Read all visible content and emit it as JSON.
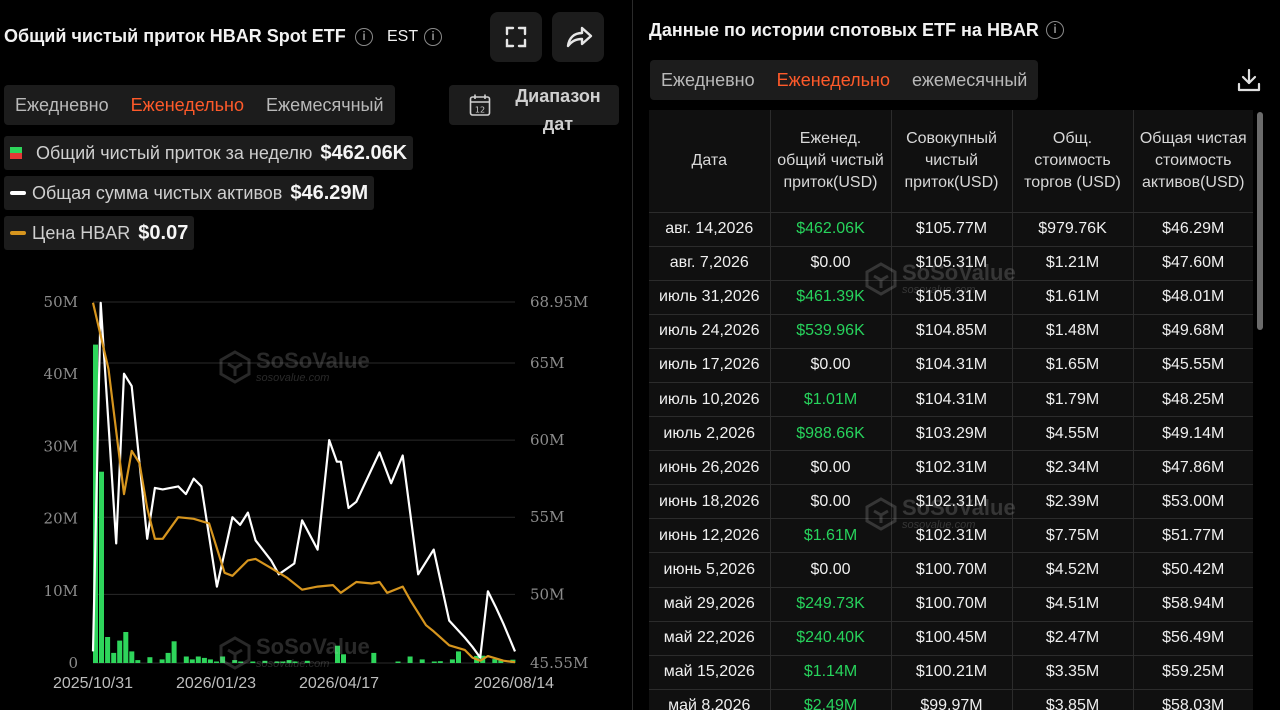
{
  "left": {
    "title": "Общий чистый приток HBAR Spot ETF",
    "timezone": "EST",
    "tabs": [
      "Ежедневно",
      "Еженедельно",
      "Ежемесячный"
    ],
    "active_tab": 1,
    "date_range": "Диапазон дат",
    "legend": [
      {
        "label": "Общий чистый приток за неделю",
        "value": "$462.06K"
      },
      {
        "label": "Общая сумма чистых активов",
        "value": "$46.29M"
      },
      {
        "label": "Цена HBAR",
        "value": "$0.07"
      }
    ],
    "watermark": {
      "name": "SoSoValue",
      "site": "sosovalue.com"
    }
  },
  "colors": {
    "accent": "#ff5a2a",
    "inflow": "#2ed55b",
    "outflow": "#e53935",
    "assets": "#ffffff",
    "price": "#d6951e"
  },
  "chart_data": {
    "type": "bar",
    "x_ticks": [
      "2025/10/31",
      "2026/01/23",
      "2026/04/17",
      "2026/08/14"
    ],
    "y_left_ticks": [
      "0",
      "10M",
      "20M",
      "30M",
      "40M",
      "50M"
    ],
    "y_right_ticks": [
      "45.55M",
      "50M",
      "55M",
      "60M",
      "65M",
      "68.95M"
    ],
    "ylim_left": [
      0,
      50000000
    ],
    "ylim_right": [
      45550000,
      68950000
    ],
    "price_range": [
      0.06,
      0.3
    ],
    "series": [
      {
        "name": "Общий чистый приток за неделю",
        "type": "bar",
        "axis": "left",
        "values": [
          44.1,
          26.5,
          3.6,
          1.4,
          3.1,
          4.3,
          1.6,
          0.4,
          0,
          0.8,
          0,
          0.5,
          1.4,
          3.0,
          0,
          0.9,
          0.5,
          0.9,
          0.7,
          0.5,
          0.2,
          0.9,
          0,
          0.4,
          0.2,
          0,
          0.1,
          0,
          0.3,
          0,
          0.1,
          0.2,
          0.4,
          0.1,
          0,
          0.3,
          0,
          0,
          0,
          0,
          2.4,
          1.2,
          0,
          0,
          0,
          0,
          1.4,
          0,
          0,
          0,
          0.2,
          0,
          0.9,
          0,
          0.5,
          0,
          0.2,
          0.25,
          0,
          0.5,
          1.61,
          0,
          0,
          0.99,
          1.01,
          0,
          0.54,
          0.46,
          0,
          0.46
        ]
      },
      {
        "name": "Общая сумма чистых активов",
        "type": "line",
        "axis": "right",
        "points": [
          [
            0,
            46.3
          ],
          [
            2,
            68.9
          ],
          [
            6,
            53.3
          ],
          [
            8,
            64.3
          ],
          [
            10,
            63.5
          ],
          [
            14,
            53.6
          ],
          [
            16,
            56.9
          ],
          [
            18,
            56.8
          ],
          [
            22,
            57.0
          ],
          [
            24,
            56.5
          ],
          [
            26,
            57.5
          ],
          [
            28,
            57.0
          ],
          [
            32,
            50.5
          ],
          [
            36,
            55.0
          ],
          [
            38,
            54.5
          ],
          [
            40,
            55.3
          ],
          [
            42,
            53.5
          ],
          [
            46,
            52.2
          ],
          [
            48,
            51.3
          ],
          [
            52,
            52.0
          ],
          [
            54,
            54.8
          ],
          [
            58,
            52.9
          ],
          [
            61,
            60.0
          ],
          [
            63,
            58.6
          ],
          [
            64,
            58.6
          ],
          [
            66,
            55.6
          ],
          [
            68,
            56.0
          ],
          [
            74,
            59.2
          ],
          [
            77,
            57.2
          ],
          [
            80,
            59.0
          ],
          [
            84,
            51.3
          ],
          [
            88,
            52.9
          ],
          [
            92,
            48.3
          ],
          [
            96,
            47.2
          ],
          [
            98,
            46.6
          ],
          [
            100,
            45.9
          ],
          [
            102,
            50.2
          ],
          [
            104,
            49.2
          ],
          [
            106,
            48.1
          ],
          [
            109,
            46.3
          ]
        ]
      },
      {
        "name": "Цена HBAR",
        "type": "line",
        "axis": "right",
        "points": [
          [
            0,
            68.9
          ],
          [
            4,
            64.6
          ],
          [
            8,
            56.5
          ],
          [
            10,
            59.3
          ],
          [
            12,
            58.5
          ],
          [
            14,
            55.6
          ],
          [
            16,
            53.6
          ],
          [
            18,
            53.6
          ],
          [
            22,
            55.0
          ],
          [
            26,
            54.9
          ],
          [
            30,
            54.6
          ],
          [
            34,
            51.4
          ],
          [
            36,
            51.2
          ],
          [
            40,
            52.2
          ],
          [
            42,
            52.3
          ],
          [
            46,
            51.7
          ],
          [
            50,
            51.1
          ],
          [
            54,
            50.3
          ],
          [
            58,
            50.5
          ],
          [
            62,
            50.6
          ],
          [
            64,
            50.1
          ],
          [
            68,
            50.8
          ],
          [
            72,
            50.7
          ],
          [
            74,
            50.8
          ],
          [
            76,
            50.1
          ],
          [
            80,
            50.5
          ],
          [
            82,
            49.6
          ],
          [
            86,
            48.0
          ],
          [
            88,
            47.6
          ],
          [
            92,
            46.7
          ],
          [
            96,
            46.4
          ],
          [
            98,
            45.9
          ],
          [
            100,
            45.7
          ],
          [
            102,
            46.0
          ],
          [
            106,
            45.7
          ],
          [
            109,
            45.6
          ]
        ]
      }
    ]
  },
  "right": {
    "title": "Данные по истории спотовых ETF на HBAR",
    "tabs": [
      "Ежедневно",
      "Еженедельно",
      "ежемесячный"
    ],
    "active_tab": 1,
    "columns": [
      "Дата",
      "Еженед. общий чистый приток(USD)",
      "Совокупный чистый приток(USD)",
      "Общ. стоимость торгов (USD)",
      "Общая чистая стоимость активов(USD)"
    ],
    "rows": [
      [
        "авг. 14,2026",
        "$462.06K",
        "$105.77M",
        "$979.76K",
        "$46.29M"
      ],
      [
        "авг. 7,2026",
        "$0.00",
        "$105.31M",
        "$1.21M",
        "$47.60M"
      ],
      [
        "июль 31,2026",
        "$461.39K",
        "$105.31M",
        "$1.61M",
        "$48.01M"
      ],
      [
        "июль 24,2026",
        "$539.96K",
        "$104.85M",
        "$1.48M",
        "$49.68M"
      ],
      [
        "июль 17,2026",
        "$0.00",
        "$104.31M",
        "$1.65M",
        "$45.55M"
      ],
      [
        "июль 10,2026",
        "$1.01M",
        "$104.31M",
        "$1.79M",
        "$48.25M"
      ],
      [
        "июль 2,2026",
        "$988.66K",
        "$103.29M",
        "$4.55M",
        "$49.14M"
      ],
      [
        "июнь 26,2026",
        "$0.00",
        "$102.31M",
        "$2.34M",
        "$47.86M"
      ],
      [
        "июнь 18,2026",
        "$0.00",
        "$102.31M",
        "$2.39M",
        "$53.00M"
      ],
      [
        "июнь 12,2026",
        "$1.61M",
        "$102.31M",
        "$7.75M",
        "$51.77M"
      ],
      [
        "июнь 5,2026",
        "$0.00",
        "$100.70M",
        "$4.52M",
        "$50.42M"
      ],
      [
        "май 29,2026",
        "$249.73K",
        "$100.70M",
        "$4.51M",
        "$58.94M"
      ],
      [
        "май 22,2026",
        "$240.40K",
        "$100.45M",
        "$2.47M",
        "$56.49M"
      ],
      [
        "май 15,2026",
        "$1.14M",
        "$100.21M",
        "$3.35M",
        "$59.25M"
      ],
      [
        "май 8,2026",
        "$2.49M",
        "$99.97M",
        "$3.85M",
        "$58.03M"
      ]
    ],
    "positive_flags": [
      true,
      false,
      true,
      true,
      false,
      true,
      true,
      false,
      false,
      true,
      false,
      true,
      true,
      true,
      true
    ]
  }
}
